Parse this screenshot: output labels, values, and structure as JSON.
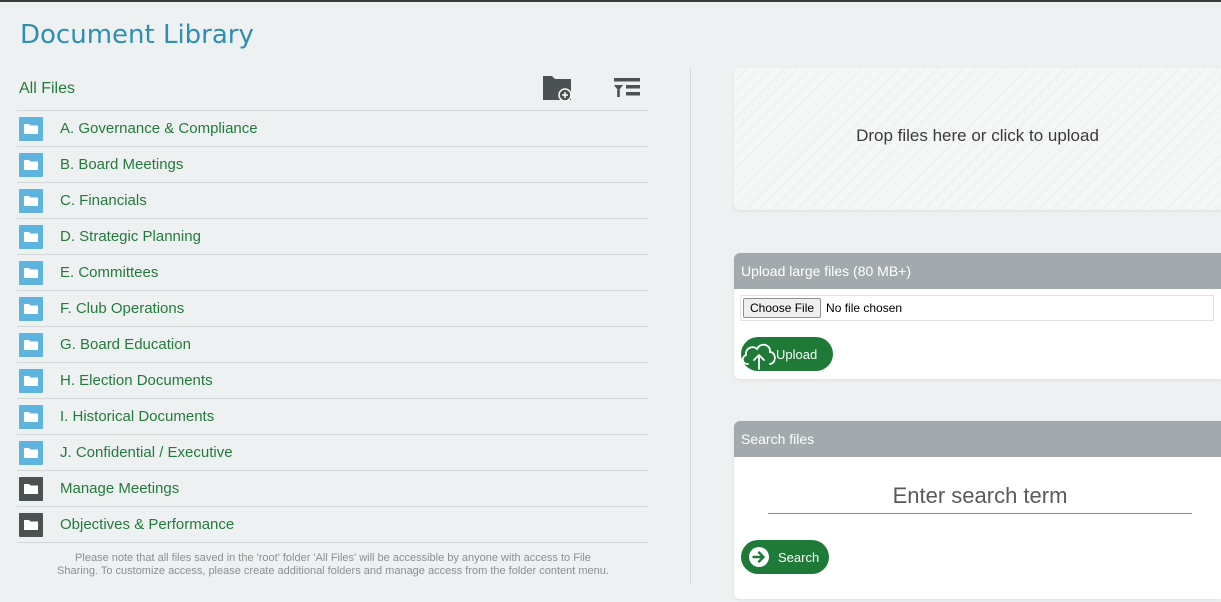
{
  "page": {
    "title": "Document Library"
  },
  "files": {
    "header": "All Files",
    "icons": {
      "new_folder": "new-folder-icon",
      "sort": "sort-list-icon",
      "folder": "folder-icon"
    },
    "folders": [
      {
        "label": "A. Governance & Compliance",
        "color": "blue"
      },
      {
        "label": "B. Board Meetings",
        "color": "blue"
      },
      {
        "label": "C. Financials",
        "color": "blue"
      },
      {
        "label": "D. Strategic Planning",
        "color": "blue"
      },
      {
        "label": "E. Committees",
        "color": "blue"
      },
      {
        "label": "F. Club Operations",
        "color": "blue"
      },
      {
        "label": "G. Board Education",
        "color": "blue"
      },
      {
        "label": "H. Election Documents",
        "color": "blue"
      },
      {
        "label": "I. Historical Documents",
        "color": "blue"
      },
      {
        "label": "J. Confidential / Executive",
        "color": "blue"
      },
      {
        "label": "Manage Meetings",
        "color": "dark"
      },
      {
        "label": "Objectives & Performance",
        "color": "dark"
      }
    ],
    "note_line1": "Please note that all files saved in the 'root' folder 'All Files' will be accessible by anyone with access to File",
    "note_line2": "Sharing. To customize access, please create additional folders and manage access from the folder content menu."
  },
  "dropzone": {
    "text": "Drop files here or click to upload"
  },
  "upload_large": {
    "title": "Upload large files (80 MB+)",
    "choose_label": "Choose File",
    "no_file": "No file chosen",
    "button_label": "Upload",
    "icon": "cloud-upload-icon"
  },
  "search": {
    "title": "Search files",
    "placeholder": "Enter search term",
    "button_label": "Search",
    "icon": "arrow-right-circle-icon"
  },
  "colors": {
    "title_blue": "#2f8fb3",
    "link_green": "#247a3c",
    "button_green": "#1f7a38",
    "folder_blue": "#5fb4dd",
    "folder_dark": "#4a5252",
    "panel_header": "#a3aaad"
  }
}
